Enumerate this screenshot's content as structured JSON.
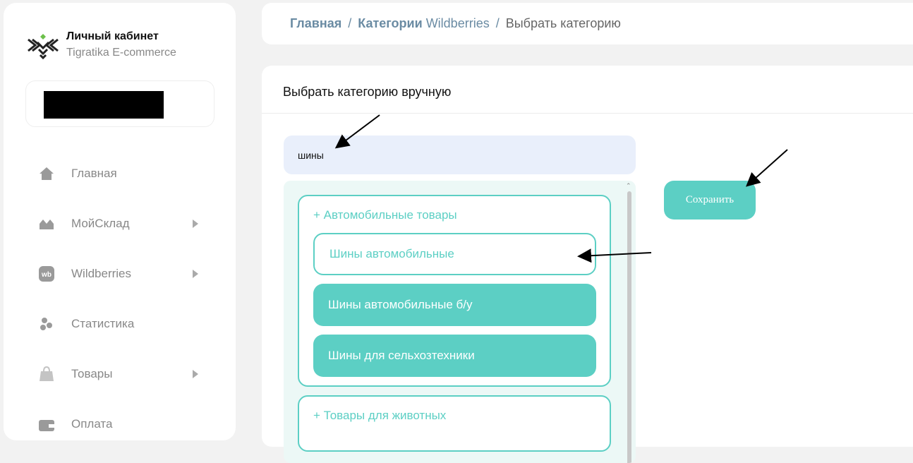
{
  "brand": {
    "title": "Личный кабинет",
    "subtitle": "Tigratika E-commerce"
  },
  "nav": {
    "items": [
      {
        "label": "Главная",
        "icon": "home-icon",
        "has_submenu": false
      },
      {
        "label": "МойСклад",
        "icon": "warehouse-icon",
        "has_submenu": true
      },
      {
        "label": "Wildberries",
        "icon": "wb-icon",
        "has_submenu": true
      },
      {
        "label": "Статистика",
        "icon": "stats-icon",
        "has_submenu": false
      },
      {
        "label": "Товары",
        "icon": "bag-icon",
        "has_submenu": true
      },
      {
        "label": "Оплата",
        "icon": "wallet-icon",
        "has_submenu": false
      }
    ]
  },
  "breadcrumb": {
    "home": "Главная",
    "categories_bold": "Категории",
    "categories_light": "Wildberries",
    "separator": "/",
    "current": "Выбрать категорию"
  },
  "main": {
    "title": "Выбрать категорию вручную",
    "search_value": "шины",
    "save_label": "Сохранить",
    "groups": [
      {
        "header": "+ Автомобильные товары",
        "options": [
          {
            "label": "Шины автомобильные",
            "state": "outline"
          },
          {
            "label": "Шины автомобильные б/у",
            "state": "filled"
          },
          {
            "label": "Шины для сельхозтехники",
            "state": "filled"
          }
        ]
      },
      {
        "header": "+ Товары для животных",
        "options": []
      }
    ]
  },
  "colors": {
    "accent": "#5ccfc4",
    "breadcrumb": "#6a8ba3",
    "input_bg": "#e9effb",
    "panel_bg": "#ecf8f6"
  }
}
